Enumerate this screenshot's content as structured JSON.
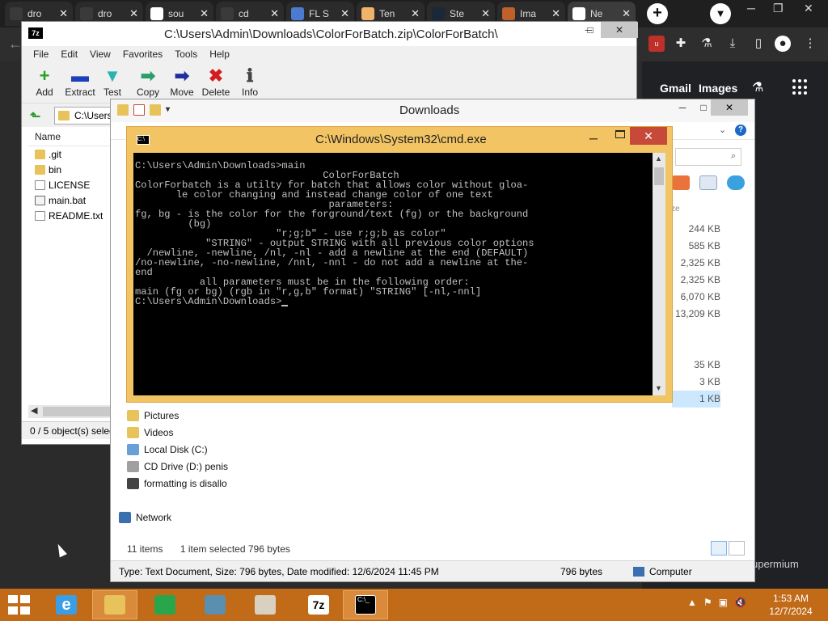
{
  "chrome": {
    "tabs": [
      {
        "title": "dro",
        "color": "#3a3a3a"
      },
      {
        "title": "dro",
        "color": "#3a3a3a"
      },
      {
        "title": "sou",
        "color": "#ffffff"
      },
      {
        "title": "cd",
        "color": "#3a3a3a"
      },
      {
        "title": "FL S",
        "color": "#4a7bd0"
      },
      {
        "title": "Ten",
        "color": "#f0b36b"
      },
      {
        "title": "Ste",
        "color": "#1b2838"
      },
      {
        "title": "Ima",
        "color": "#c0602a"
      },
      {
        "title": "Ne",
        "color": "#ffffff"
      }
    ],
    "new_tab": "+",
    "gmail": "Gmail",
    "images": "Images",
    "footer_text": "upermium"
  },
  "zip": {
    "title": "C:\\Users\\Admin\\Downloads\\ColorForBatch.zip\\ColorForBatch\\",
    "app_icon": "7z",
    "menu": [
      "File",
      "Edit",
      "View",
      "Favorites",
      "Tools",
      "Help"
    ],
    "toolbar": [
      {
        "label": "Add",
        "glyph": "+",
        "color": "#1fa51f"
      },
      {
        "label": "Extract",
        "glyph": "▬",
        "color": "#1d3fb8"
      },
      {
        "label": "Test",
        "glyph": "▼",
        "color": "#29b3b3"
      },
      {
        "label": "Copy",
        "glyph": "➡",
        "color": "#2a9d6a"
      },
      {
        "label": "Move",
        "glyph": "➡",
        "color": "#1f2fa0"
      },
      {
        "label": "Delete",
        "glyph": "✖",
        "color": "#d41e1e"
      },
      {
        "label": "Info",
        "glyph": "ℹ",
        "color": "#444444"
      }
    ],
    "path": "C:\\Users",
    "column_name": "Name",
    "files": [
      {
        "name": ".git",
        "kind": "folder"
      },
      {
        "name": "bin",
        "kind": "folder"
      },
      {
        "name": "LICENSE",
        "kind": "file"
      },
      {
        "name": "main.bat",
        "kind": "bat"
      },
      {
        "name": "README.txt",
        "kind": "file"
      }
    ],
    "status": "0 / 5 object(s) selec"
  },
  "explorer": {
    "title": "Downloads",
    "size_header": "ze",
    "sizes": [
      "244 KB",
      "585 KB",
      "2,325 KB",
      "2,325 KB",
      "6,070 KB",
      "13,209 KB",
      "",
      "",
      "35 KB",
      "3 KB",
      "1 KB"
    ],
    "nav": [
      {
        "label": "Pictures",
        "color": "#e8c25a"
      },
      {
        "label": "Videos",
        "color": "#e8c25a"
      },
      {
        "label": "Local Disk (C:)",
        "color": "#6aa0d8"
      },
      {
        "label": "CD Drive (D:) penis",
        "color": "#a0a0a0"
      },
      {
        "label": "formatting is disallo",
        "color": "#444444"
      },
      {
        "label": "",
        "color": ""
      },
      {
        "label": "Network",
        "color": "#3a6fb0"
      }
    ],
    "status_items": "11 items",
    "status_selected": "1 item selected  796 bytes",
    "details_type": "Type: Text Document, Size: 796 bytes, Date modified: 12/6/2024 11:45 PM",
    "details_size": "796 bytes",
    "details_location": "Computer"
  },
  "cmd": {
    "title": "C:\\Windows\\System32\\cmd.exe",
    "lines": [
      "C:\\Users\\Admin\\Downloads>main",
      "",
      "                                ColorForBatch",
      "ColorForbatch is a utilty for batch that allows color without gloa-",
      "       le color changing and instead change color of one text",
      "",
      "                                 parameters:",
      "",
      "fg, bg - is the color for the forground/text (fg) or the background",
      "         (bg)",
      "",
      "                        \"r;g;b\" - use r;g;b as color\"",
      "",
      "            \"STRING\" - output STRING with all previous color options",
      "",
      "  /newline, -newline, /nl, -nl - add a newline at the end (DEFAULT)",
      "",
      "/no-newline, -no-newline, /nnl, -nnl - do not add a newline at the-",
      "end",
      "           all parameters must be in the following order:",
      "main (fg or bg) (rgb in \"r,g,b\" format) \"STRING\" [-nl,-nnl]",
      "",
      "",
      "C:\\Users\\Admin\\Downloads>"
    ]
  },
  "taskbar": {
    "apps": [
      {
        "name": "internet-explorer",
        "glyph": "e",
        "color": "#3a9ee6"
      },
      {
        "name": "file-explorer",
        "glyph": "",
        "color": "#e8c25a"
      },
      {
        "name": "store",
        "glyph": "",
        "color": "#2aa64a"
      },
      {
        "name": "browser",
        "glyph": "",
        "color": "#5a8fb0"
      },
      {
        "name": "paint",
        "glyph": "",
        "color": "#d8d0c0"
      }
    ],
    "seven_zip": "7z",
    "cmd_glyph": "C:\\_",
    "tray": [
      "▲",
      "⚑",
      "▣",
      "🔇"
    ],
    "time": "1:53 AM",
    "date": "12/7/2024"
  }
}
